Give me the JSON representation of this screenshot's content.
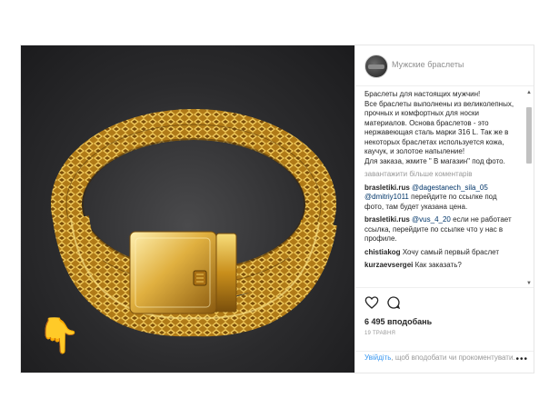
{
  "post": {
    "username": "Мужские браслеты",
    "caption": "Браслеты для настоящих мужчин!\nВсе браслеты выполнены из великолепных, прочных и комфортных для носки материалов. Основа браслетов - это нержавеющая сталь марки 316 L. Так же в некоторых браслетах используется кожа, каучук, и золотое напыление!\nДля заказа, жмите \" В магазин\" под фото.",
    "load_more": "завантажити більше коментарів",
    "comments": [
      {
        "user": "brasletiki.rus",
        "mention": "@dagestanech_sila_05 @dmitriy1011",
        "text": "перейдите по ссылке под фото, там будет указана цена."
      },
      {
        "user": "brasletiki.rus",
        "mention": "@vus_4_20",
        "text": "если не работает ссылка, перейдите по ссылке что у нас в профиле."
      },
      {
        "user": "chistiakog",
        "mention": "",
        "text": "Хочу самый первый браслет"
      },
      {
        "user": "kurzaevsergei",
        "mention": "",
        "text": "Как заказать?"
      }
    ],
    "likes": "6 495 вподобань",
    "date": "19 ТРАВНЯ",
    "login_link": "Увійдіть",
    "login_rest": ", щоб вподобати чи прокоментувати.",
    "more_dots": "•••"
  },
  "icons": {
    "heart": "heart-icon",
    "comment": "comment-icon",
    "pointing_hand": "pointing-down-hand-icon"
  },
  "colors": {
    "link": "#3897f0",
    "gold": "#d9a93a",
    "background_photo": "#2b2b2d"
  }
}
